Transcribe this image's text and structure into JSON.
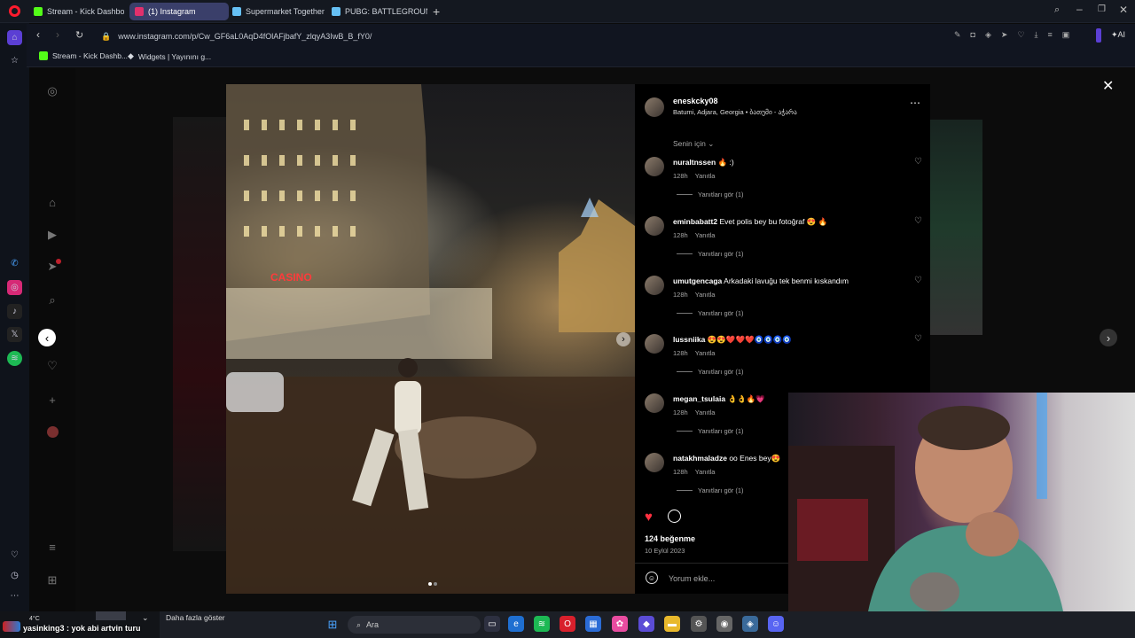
{
  "browser": {
    "tabs": [
      {
        "label": "Stream - Kick Dashboard",
        "icon": "kick-icon",
        "color": "#53fc18",
        "active": false
      },
      {
        "label": "(1) Instagram",
        "icon": "instagram-icon",
        "color": "#e1306c",
        "active": true
      },
      {
        "label": "Supermarket Together Ste",
        "icon": "steam-icon",
        "color": "#66c0f4",
        "active": false
      },
      {
        "label": "PUBG: BATTLEGROUNDS",
        "icon": "steam-icon",
        "color": "#66c0f4",
        "active": false
      }
    ],
    "url": "www.instagram.com/p/Cw_GF6aL0AqD4fOlAFjbafY_zlqyA3IwB_B_fY0/",
    "ai_label": "AI",
    "bookmarks": [
      {
        "label": "Stream - Kick Dashb...",
        "icon": "kick-icon"
      },
      {
        "label": "Widgets | Yayınını g...",
        "icon": "widgets-icon"
      }
    ]
  },
  "post": {
    "username": "eneskcky08",
    "location": "Batumi, Adjara, Georgia • ბათუმი - აჭარა",
    "filter_label": "Senin için",
    "comments": [
      {
        "user": "nuraltnssen",
        "text": "🔥 :)",
        "time": "128h",
        "reply": "Yanıtla",
        "view_replies": "Yanıtları gör (1)"
      },
      {
        "user": "eminbabatt2",
        "text": "Evet polis bey bu fotoğraf 😍 🔥",
        "time": "128h",
        "reply": "Yanıtla",
        "view_replies": "Yanıtları gör (1)"
      },
      {
        "user": "umutgencaga",
        "text": "Arkadaki lavuğu tek benmi kıskandım",
        "time": "128h",
        "reply": "Yanıtla",
        "view_replies": "Yanıtları gör (1)"
      },
      {
        "user": "lussniika",
        "text": "😍😍❤️❤️❤️🧿🧿🧿🧿",
        "time": "128h",
        "reply": "Yanıtla",
        "view_replies": "Yanıtları gör (1)"
      },
      {
        "user": "megan_tsulaia",
        "text": "👌👌🔥💗",
        "time": "128h",
        "reply": "Yanıtla",
        "view_replies": "Yanıtları gör (1)"
      },
      {
        "user": "natakhmaladze",
        "text": "oo Enes bey😍",
        "time": "128h",
        "reply": "Yanıtla",
        "view_replies": "Yanıtları gör (1)"
      }
    ],
    "likes": "124 beğenme",
    "date": "10 Eylül 2023",
    "comment_placeholder": "Yorum ekle...",
    "photo_signs": [
      "CASINO"
    ]
  },
  "taskbar": {
    "chat_message": "yasinking3 : yok abi artvin turu",
    "weather": "4°C",
    "more_label": "Daha fazla göster",
    "search_label": "Ara"
  },
  "colors": {
    "accent": "#3a3f6a",
    "like_red": "#ff3040",
    "ig_bg": "#000000"
  }
}
